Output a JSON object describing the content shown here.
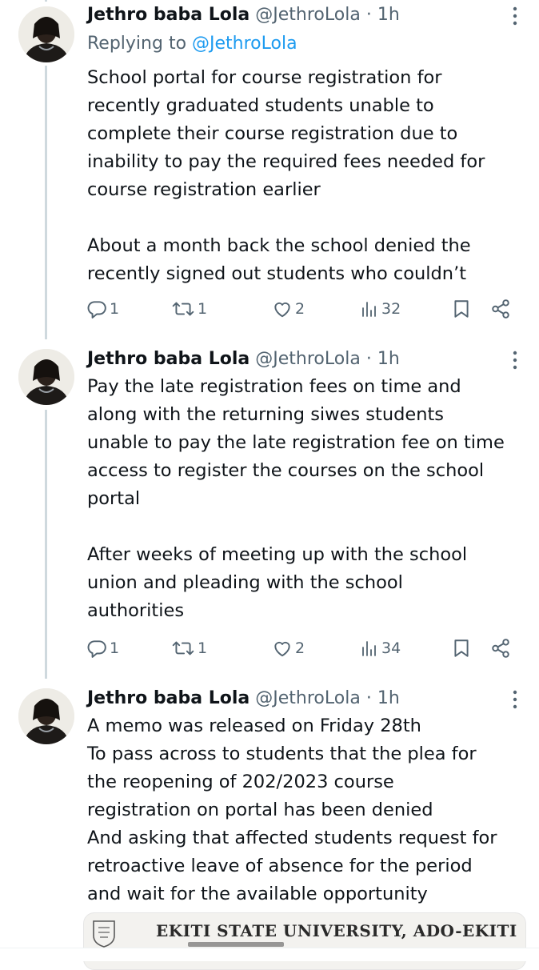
{
  "colors": {
    "text": "#0f1419",
    "secondary": "#536471",
    "link": "#1d9bf0",
    "thread_line": "#cfd9de"
  },
  "tweets": [
    {
      "author_name": "Jethro baba Lola",
      "handle": "@JethroLola",
      "separator": "·",
      "time": "1h",
      "reply_context": {
        "prefix": "Replying to",
        "handle": "@JethroLola"
      },
      "text": "School portal for course registration for\nrecently graduated students unable to\ncomplete their course registration due to\ninability to pay the required fees needed for\ncourse registration earlier\n\nAbout a month back the school denied the\nrecently signed out students who couldn’t",
      "actions": {
        "replies": "1",
        "reposts": "1",
        "likes": "2",
        "views": "32"
      }
    },
    {
      "author_name": "Jethro baba Lola",
      "handle": "@JethroLola",
      "separator": "·",
      "time": "1h",
      "text": "Pay the late registration fees on time and\nalong with the returning siwes students\nunable to pay the late registration fee on time\naccess to register the courses on the school\nportal\n\nAfter weeks of meeting up with the school\nunion and pleading with the school\nauthorities",
      "actions": {
        "replies": "1",
        "reposts": "1",
        "likes": "2",
        "views": "34"
      }
    },
    {
      "author_name": "Jethro baba Lola",
      "handle": "@JethroLola",
      "separator": "·",
      "time": "1h",
      "text": "A memo was released on Friday 28th\nTo pass across to students that the plea for\nthe reopening of 202/2023 course\nregistration on portal has been denied\nAnd asking that affected students request for\nretroactive leave of absence for the period\nand wait for the available opportunity",
      "media": {
        "title": "EKITI STATE UNIVERSITY, ADO-EKITI"
      }
    }
  ],
  "icons": {
    "more": "more-vertical-icon",
    "reply": "reply-icon",
    "repost": "repost-icon",
    "like": "like-icon",
    "views": "views-icon",
    "bookmark": "bookmark-icon",
    "share": "share-icon"
  }
}
